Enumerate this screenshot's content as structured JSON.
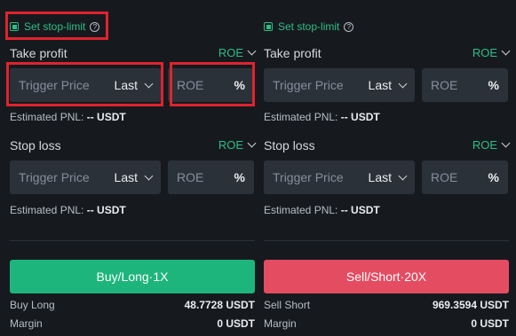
{
  "panels": [
    {
      "id": "left",
      "stop_limit_label": "Set stop-limit",
      "take_profit": {
        "title": "Take profit",
        "mode": "ROE",
        "trigger_placeholder": "Trigger Price",
        "price_type": "Last",
        "roe_placeholder": "ROE",
        "unit": "%",
        "pnl_label": "Estimated PNL:",
        "pnl_value": "-- USDT"
      },
      "stop_loss": {
        "title": "Stop loss",
        "mode": "ROE",
        "trigger_placeholder": "Trigger Price",
        "price_type": "Last",
        "roe_placeholder": "ROE",
        "unit": "%",
        "pnl_label": "Estimated PNL:",
        "pnl_value": "-- USDT"
      },
      "action_button": "Buy/Long·1X",
      "action_color": "#1eb57d",
      "summary": [
        {
          "label": "Buy Long",
          "value": "48.7728 USDT"
        },
        {
          "label": "Margin",
          "value": "0 USDT"
        }
      ]
    },
    {
      "id": "right",
      "stop_limit_label": "Set stop-limit",
      "take_profit": {
        "title": "Take profit",
        "mode": "ROE",
        "trigger_placeholder": "Trigger Price",
        "price_type": "Last",
        "roe_placeholder": "ROE",
        "unit": "%",
        "pnl_label": "Estimated PNL:",
        "pnl_value": "-- USDT"
      },
      "stop_loss": {
        "title": "Stop loss",
        "mode": "ROE",
        "trigger_placeholder": "Trigger Price",
        "price_type": "Last",
        "roe_placeholder": "ROE",
        "unit": "%",
        "pnl_label": "Estimated PNL:",
        "pnl_value": "-- USDT"
      },
      "action_button": "Sell/Short·20X",
      "action_color": "#e44c62",
      "summary": [
        {
          "label": "Sell Short",
          "value": "969.3594 USDT"
        },
        {
          "label": "Margin",
          "value": "0 USDT"
        }
      ]
    }
  ],
  "colors": {
    "background": "#161a1e",
    "field": "#2b3139",
    "accent_green": "#2ebd85",
    "highlight_red": "#e0232f"
  },
  "icons": [
    "checkbox-checked-icon",
    "question-circle-icon",
    "chevron-down-icon"
  ]
}
